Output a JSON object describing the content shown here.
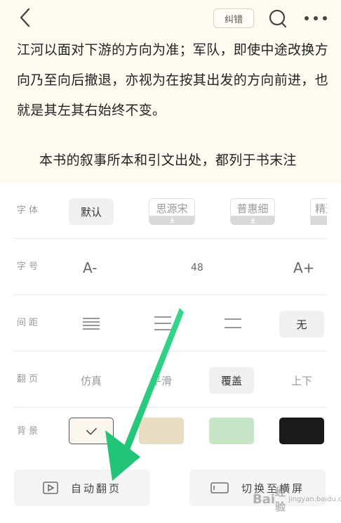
{
  "header": {
    "report_label": "纠错"
  },
  "reading": {
    "paragraph_1": "江河以面对下游的方向为准；军队，即使中途改换方向乃至向后撤退，亦视为在按其出发的方向前进，也就是其左其右始终不变。",
    "paragraph_2": "本书的叙事所本和引文出处，都列于书末注"
  },
  "settings": {
    "font": {
      "label": "字体",
      "options": [
        "默认",
        "思源宋",
        "普惠细",
        "精选"
      ],
      "selected": "默认"
    },
    "font_size": {
      "label": "字号",
      "decrease": "A-",
      "value": "48",
      "increase": "A+"
    },
    "spacing": {
      "label": "间距",
      "none_label": "无",
      "selected": "无"
    },
    "page_turn": {
      "label": "翻页",
      "options": [
        "仿真",
        "平滑",
        "覆盖",
        "上下"
      ],
      "selected": "覆盖"
    },
    "background": {
      "label": "背景",
      "swatches": [
        "#fbf7ee",
        "#e8dcc3",
        "#c6e5c6",
        "#1a1a1a"
      ],
      "selected_index": 0
    }
  },
  "footer": {
    "auto_page_label": "自动翻页",
    "landscape_label": "切换至横屏"
  },
  "watermark": {
    "brand": "Bai",
    "brand_cn": "经验",
    "site": "jingyan.baidu.com"
  },
  "colors": {
    "reading_bg": "#fdfaf0",
    "arrow": "#2fcf7f"
  }
}
